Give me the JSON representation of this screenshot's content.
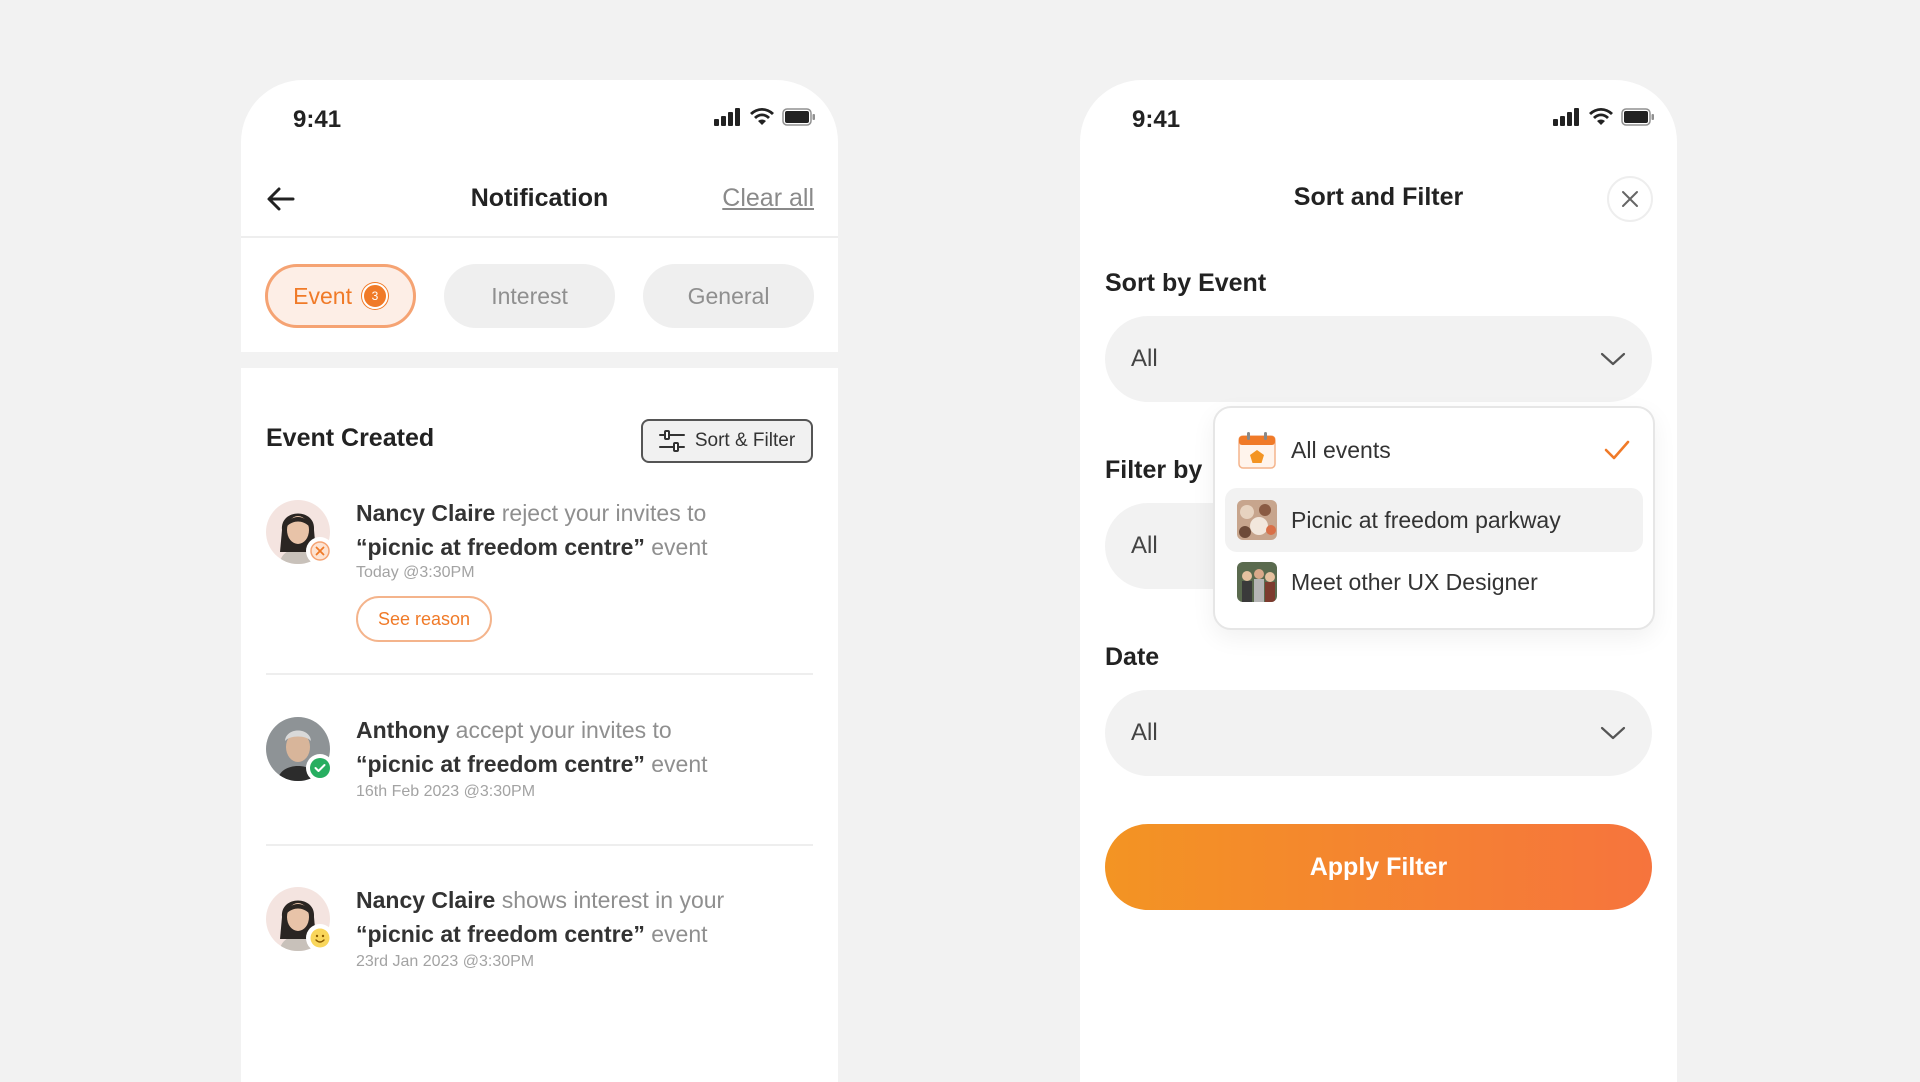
{
  "status": {
    "time": "9:41"
  },
  "notifications_screen": {
    "title": "Notification",
    "clear_all": "Clear all",
    "tabs": [
      {
        "label": "Event",
        "badge": "3",
        "active": true
      },
      {
        "label": "Interest",
        "active": false
      },
      {
        "label": "General",
        "active": false
      }
    ],
    "section_title": "Event Created",
    "sort_filter_label": "Sort & Filter",
    "items": [
      {
        "name": "Nancy Claire",
        "action": " reject your invites to",
        "event": "“picnic at freedom centre”",
        "suffix": " event",
        "time": "Today @3:30PM",
        "button": "See reason",
        "status": "rejected"
      },
      {
        "name": "Anthony",
        "action": " accept your invites to",
        "event": "“picnic at freedom centre”",
        "suffix": " event",
        "time": "16th Feb 2023 @3:30PM",
        "status": "accepted"
      },
      {
        "name": "Nancy Claire",
        "action": " shows interest in your",
        "event": "“picnic at freedom centre”",
        "suffix": " event",
        "time": "23rd Jan 2023 @3:30PM",
        "status": "interested"
      }
    ]
  },
  "filter_screen": {
    "title": "Sort and Filter",
    "sort_label": "Sort by Event",
    "sort_value": "All",
    "filter_label": "Filter by",
    "filter_value": "All",
    "date_label": "Date",
    "date_value": "All",
    "apply_label": "Apply Filter",
    "dropdown": [
      {
        "label": "All events",
        "icon": "calendar-icon",
        "selected": true
      },
      {
        "label": "Picnic at freedom parkway",
        "icon": "event-thumbnail",
        "selected": false
      },
      {
        "label": "Meet other UX Designer",
        "icon": "event-thumbnail",
        "selected": false
      }
    ]
  },
  "colors": {
    "accent": "#f07a28",
    "gradient_start": "#f39423",
    "gradient_end": "#f6743d",
    "success": "#27ae60"
  }
}
